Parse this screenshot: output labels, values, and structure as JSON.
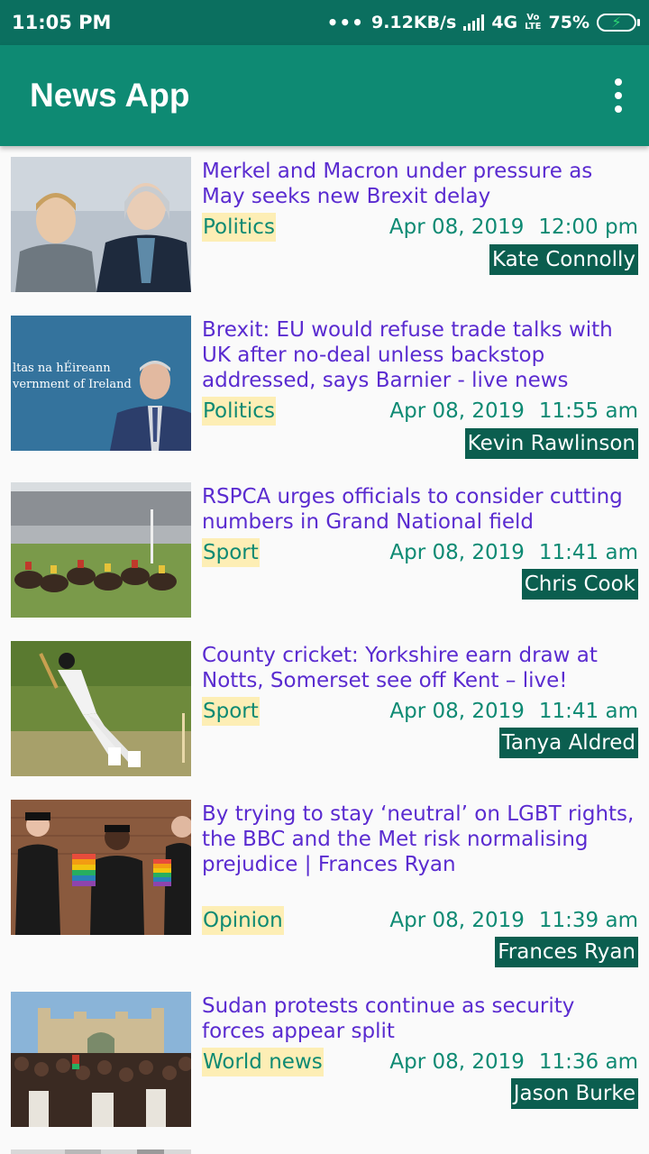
{
  "status_bar": {
    "time": "11:05 PM",
    "dots": "•••",
    "speed": "9.12KB/s",
    "network": "4G",
    "volte_top": "Vo",
    "volte_bottom": "LTE",
    "battery": "75%",
    "icons": [
      "signal-icon",
      "battery-charging-icon"
    ]
  },
  "app_bar": {
    "title": "News App",
    "menu_icon": "more-vert-icon"
  },
  "colors": {
    "status_bar": "#0b6f5f",
    "app_bar": "#0e8a73",
    "headline": "#5a2bd0",
    "section_bg": "#fdeeb5",
    "author_bg": "#0b5e4f"
  },
  "articles": [
    {
      "headline": "Merkel and Macron under pressure as May seeks new Brexit delay",
      "section": "Politics",
      "date": "Apr 08, 2019",
      "time": "12:00 pm",
      "author": "Kate Connolly"
    },
    {
      "headline": "Brexit: EU would refuse trade talks with UK after no-deal unless backstop addressed, says Barnier - live news",
      "section": "Politics",
      "date": "Apr 08, 2019",
      "time": "11:55 am",
      "author": "Kevin Rawlinson",
      "image_text_1": "ltas na hÉireann",
      "image_text_2": "vernment of Ireland"
    },
    {
      "headline": "RSPCA urges officials to consider cutting numbers in Grand National field",
      "section": "Sport",
      "date": "Apr 08, 2019",
      "time": "11:41 am",
      "author": "Chris Cook"
    },
    {
      "headline": "County cricket: Yorkshire earn draw at Notts, Somerset see off Kent – live!",
      "section": "Sport",
      "date": "Apr 08, 2019",
      "time": "11:41 am",
      "author": "Tanya Aldred"
    },
    {
      "headline": "By trying to stay ‘neutral’ on LGBT rights, the BBC and the Met risk normalising prejudice | Frances Ryan",
      "section": "Opinion",
      "date": "Apr 08, 2019",
      "time": "11:39 am",
      "author": "Frances Ryan"
    },
    {
      "headline": "Sudan protests continue as security forces appear split",
      "section": "World news",
      "date": "Apr 08, 2019",
      "time": "11:36 am",
      "author": "Jason Burke"
    }
  ]
}
